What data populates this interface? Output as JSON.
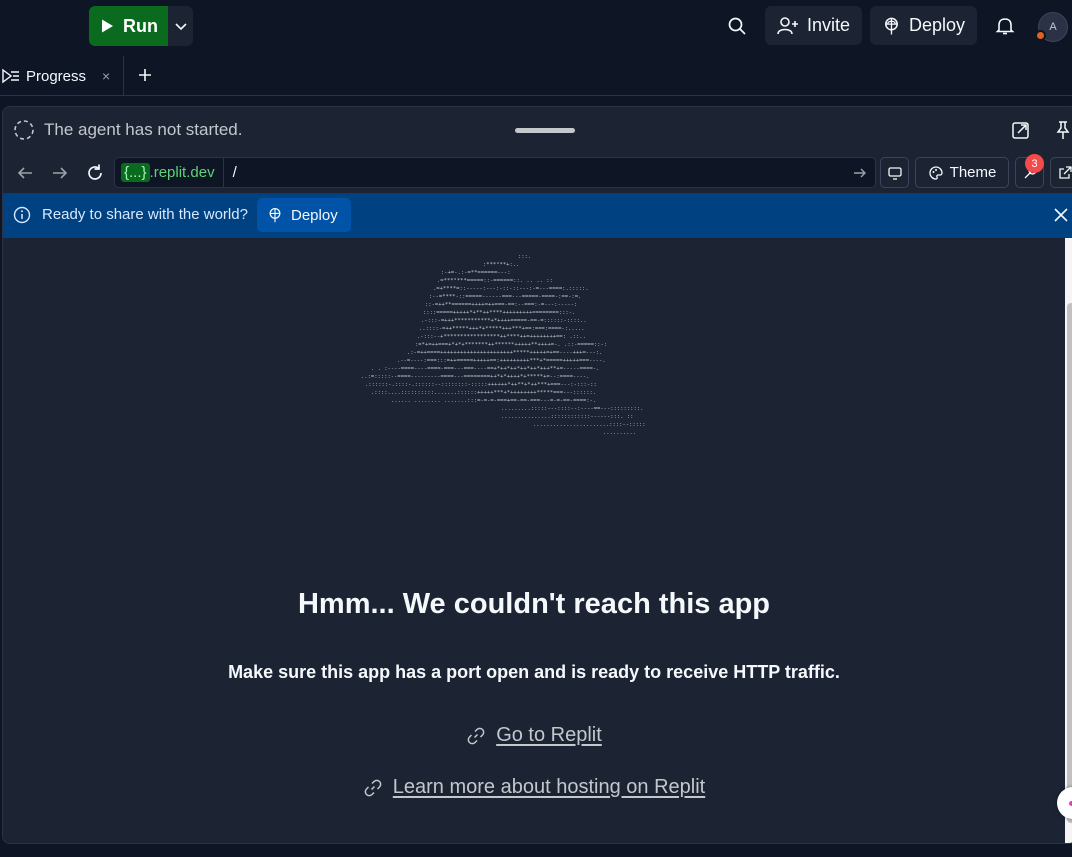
{
  "topbar": {
    "run_label": "Run",
    "invite_label": "Invite",
    "deploy_label": "Deploy",
    "avatar_initial": "A"
  },
  "tabs": [
    {
      "label": "Progress",
      "close": "×"
    }
  ],
  "agent": {
    "status": "The agent has not started."
  },
  "browser": {
    "domain_brace": "{...}",
    "domain_suffix": ".replit.dev",
    "path": "/",
    "theme_label": "Theme",
    "devtools_badge": "3"
  },
  "banner": {
    "text": "Ready to share with the world?",
    "deploy_label": "Deploy"
  },
  "error_page": {
    "headline": "Hmm... We couldn't reach this app",
    "subline": "Make sure this app has a port open and is ready to receive HTTP traffic.",
    "link_replit": "Go to Replit",
    "link_hosting": "Learn more about hosting on Replit"
  },
  "colors": {
    "run_green": "#0a6a1d",
    "banner_blue": "#004182",
    "badge_red": "#f44a4a",
    "background": "#0e1525",
    "surface": "#1c2333"
  },
  "icons": {
    "run": "play-icon",
    "search": "search-icon",
    "invite": "add-user-icon",
    "deploy": "deploy-icon",
    "bell": "bell-icon",
    "tab": "progress-icon",
    "info": "info-icon",
    "link": "link-icon"
  }
}
